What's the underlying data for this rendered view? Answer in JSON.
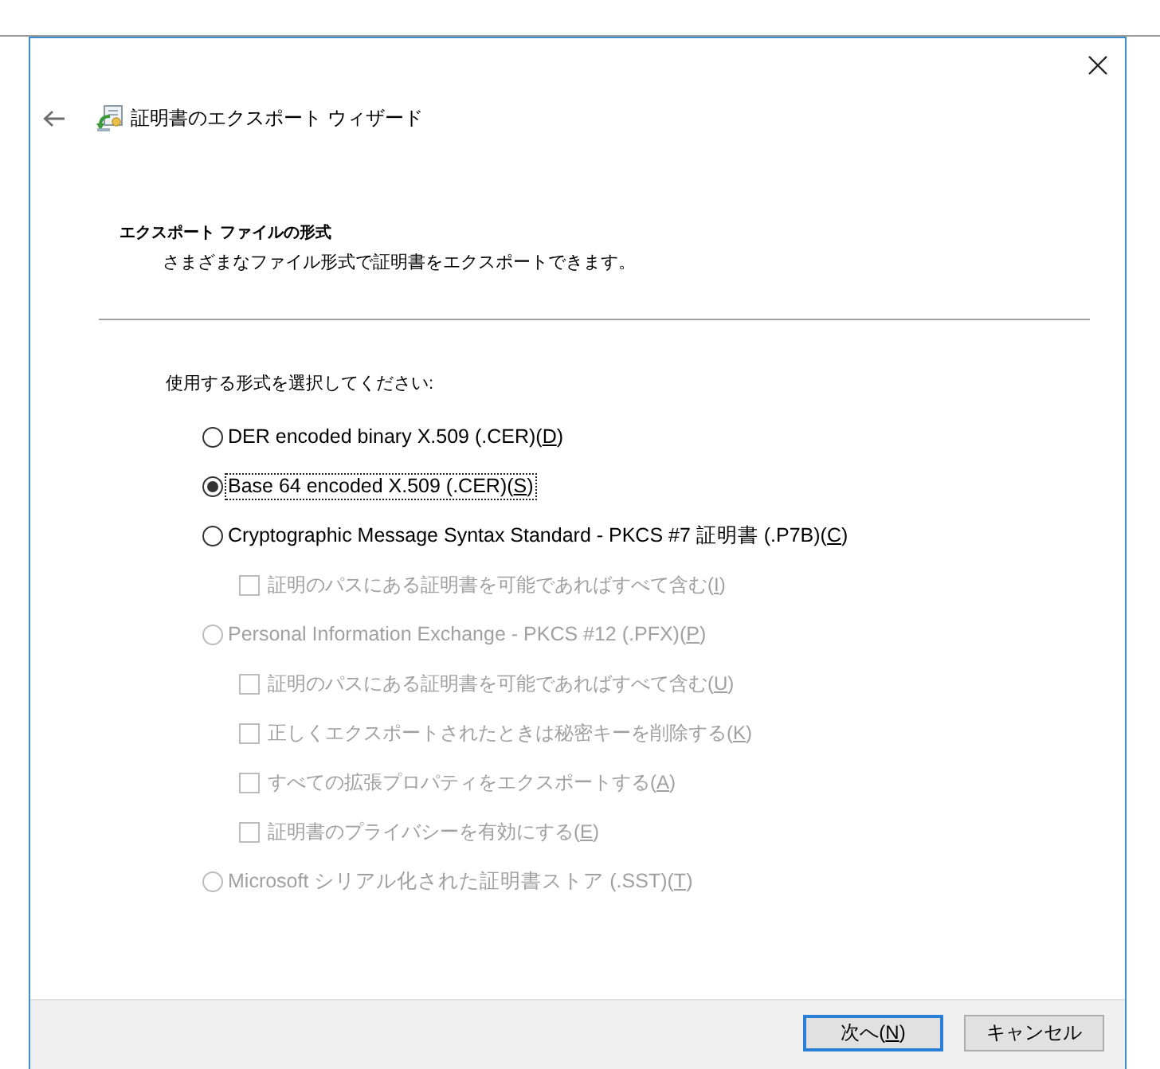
{
  "window": {
    "title": "証明書のエクスポート ウィザード"
  },
  "header": {
    "title": "エクスポート ファイルの形式",
    "description": "さまざまなファイル形式で証明書をエクスポートできます。"
  },
  "prompt": "使用する形式を選択してください:",
  "formats": [
    {
      "label": "DER encoded binary X.509 (.CER)(D)",
      "selected": false,
      "disabled": false
    },
    {
      "label": "Base 64 encoded X.509 (.CER)(S)",
      "selected": true,
      "disabled": false
    },
    {
      "label": "Cryptographic Message Syntax Standard - PKCS #7 証明書 (.P7B)(C)",
      "selected": false,
      "disabled": false,
      "options": [
        {
          "label": "証明のパスにある証明書を可能であればすべて含む(I)",
          "checked": false,
          "disabled": true
        }
      ]
    },
    {
      "label": "Personal Information Exchange - PKCS #12 (.PFX)(P)",
      "selected": false,
      "disabled": true,
      "options": [
        {
          "label": "証明のパスにある証明書を可能であればすべて含む(U)",
          "checked": false,
          "disabled": true
        },
        {
          "label": "正しくエクスポートされたときは秘密キーを削除する(K)",
          "checked": false,
          "disabled": true
        },
        {
          "label": "すべての拡張プロパティをエクスポートする(A)",
          "checked": false,
          "disabled": true
        },
        {
          "label": "証明書のプライバシーを有効にする(E)",
          "checked": false,
          "disabled": true
        }
      ]
    },
    {
      "label": "Microsoft シリアル化された証明書ストア (.SST)(T)",
      "selected": false,
      "disabled": true
    }
  ],
  "buttons": [
    {
      "label": "次へ(N)",
      "default": true,
      "access_key": true
    },
    {
      "label": "キャンセル",
      "default": false,
      "access_key": false
    }
  ]
}
